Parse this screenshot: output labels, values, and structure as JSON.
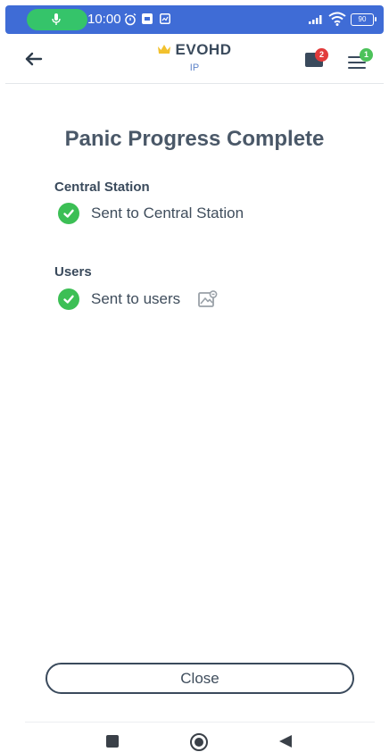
{
  "status_bar": {
    "time": "10:00",
    "battery": "90",
    "icons": [
      "mic-icon",
      "alarm-icon",
      "notification-icon",
      "screenshot-icon",
      "signal-icon",
      "wifi-icon",
      "battery-icon"
    ]
  },
  "header": {
    "title": "EVOHD",
    "subtitle": "IP",
    "notifications_badge": "2",
    "menu_badge": "1",
    "icons": [
      "back-arrow-icon",
      "crown-icon",
      "notification-icon",
      "menu-icon"
    ]
  },
  "main": {
    "title": "Panic Progress Complete",
    "sections": [
      {
        "title": "Central Station",
        "status_text": "Sent to Central Station"
      },
      {
        "title": "Users",
        "status_text": "Sent to users"
      }
    ]
  },
  "close_label": "Close",
  "colors": {
    "status_bar": "#3f6cd6",
    "success": "#3cbf55",
    "text": "#3a4a5c",
    "badge_red": "#e23a3a",
    "badge_green": "#4cc25a",
    "crown": "#f2c12e"
  },
  "nav_bar": {
    "icons": [
      "recents-icon",
      "home-icon",
      "back-icon"
    ]
  }
}
